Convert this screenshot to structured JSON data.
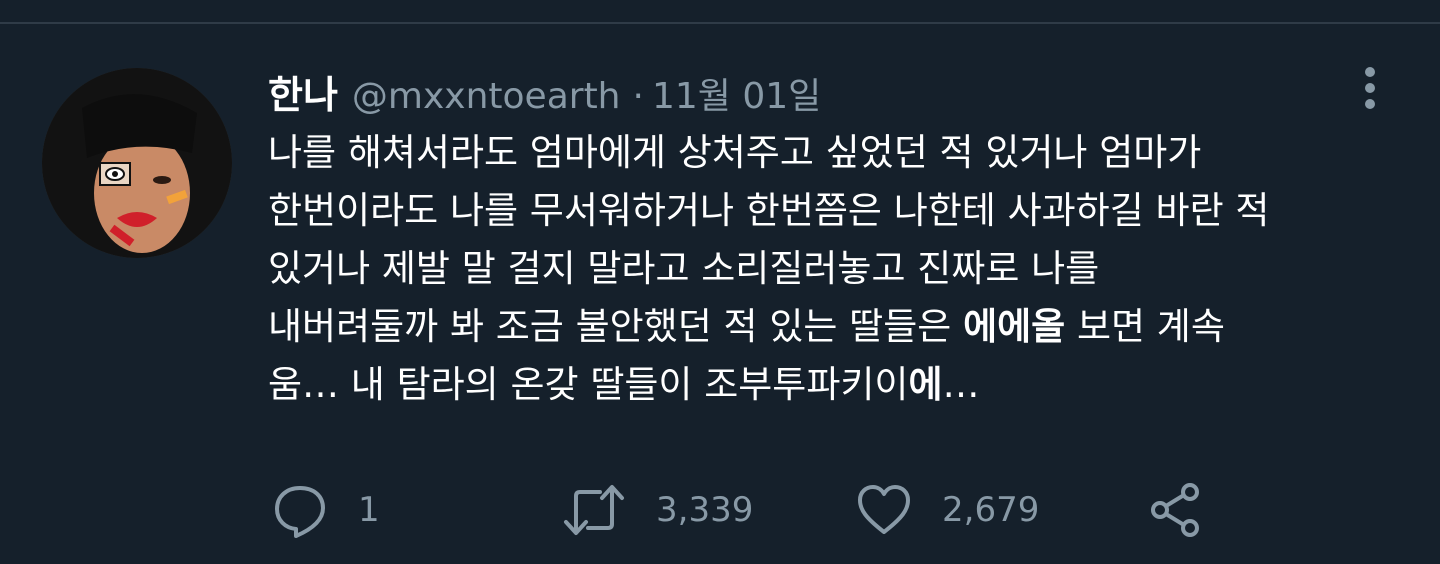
{
  "tweet": {
    "display_name": "한나",
    "handle": "@mxxntoearth",
    "separator": "·",
    "date": "11월 01일",
    "body_lines": [
      "나를 해쳐서라도 엄마에게 상처주고 싶었던 적 있거나 엄마가",
      "한번이라도 나를 무서워하거나 한번쯤은 나한테 사과하길 바란 적",
      "있거나 제발 말 걸지 말라고 소리질러놓고 진짜로 나를"
    ],
    "body_line4_prefix": "내버려둘까 봐 조금 불안했던 적 있는 딸들은 ",
    "body_line4_bold": "에에올",
    "body_line4_suffix": " 보면 계속",
    "body_line5_prefix": "움… 내 탐라의 온갖 딸들이 조부투파키이",
    "body_line5_bold": "에",
    "body_line5_suffix": "…"
  },
  "actions": {
    "reply_count": "1",
    "retweet_count": "3,339",
    "like_count": "2,679"
  },
  "icons": {
    "more": "more-vertical-icon",
    "reply": "reply-icon",
    "retweet": "retweet-icon",
    "like": "heart-icon",
    "share": "share-icon"
  },
  "colors": {
    "background": "#15202b",
    "text": "#ffffff",
    "muted": "#8899a6"
  }
}
